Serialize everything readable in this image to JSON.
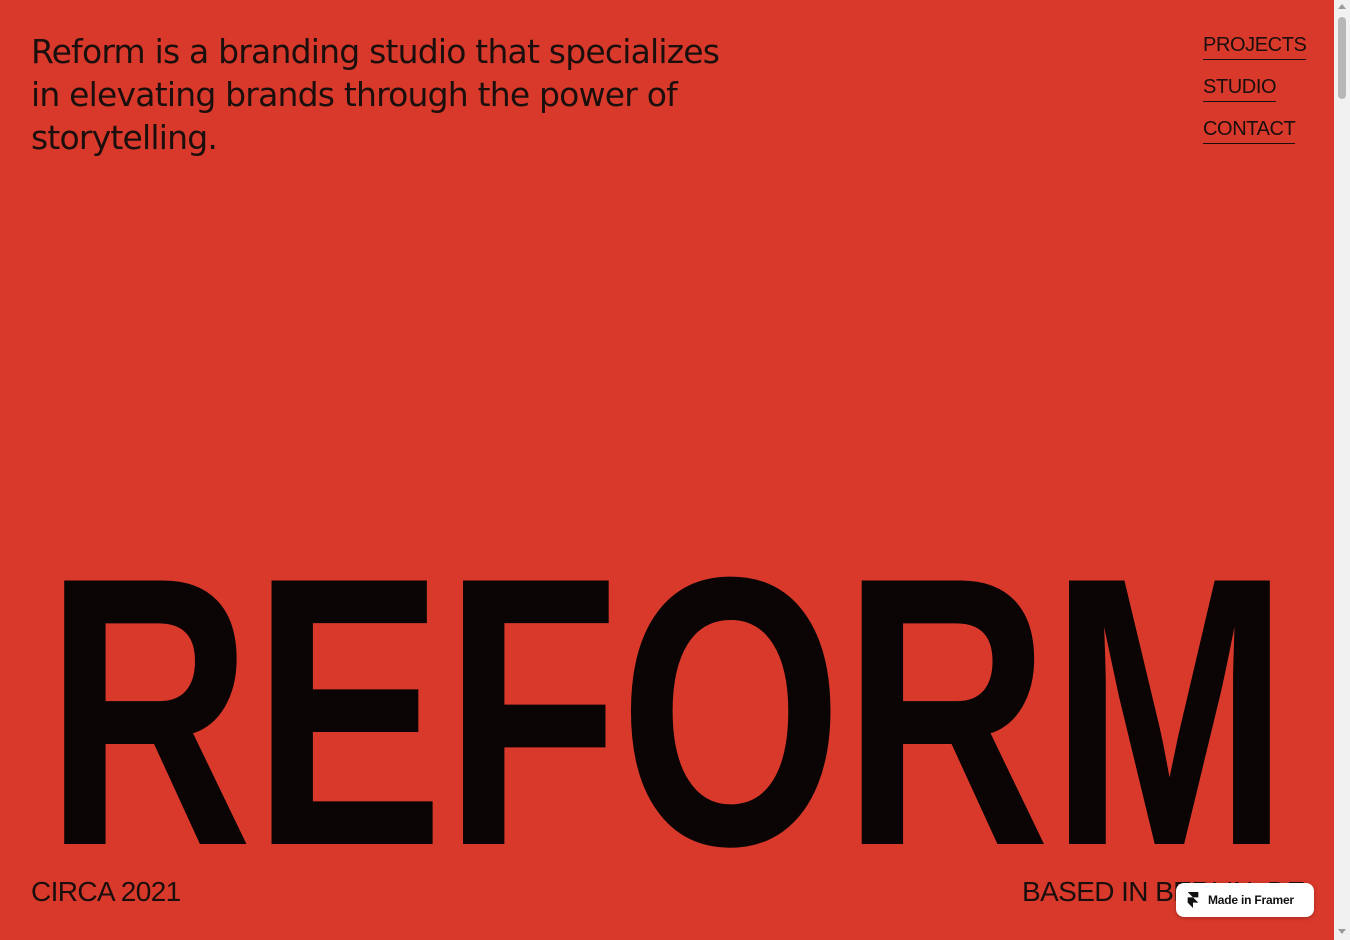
{
  "colors": {
    "background": "#d9392b",
    "ink": "#1a0f0d",
    "wordmark": "#0a0504",
    "badge_bg": "#ffffff"
  },
  "hero": {
    "tagline": "Reform is a branding studio that specializes in elevating brands through the power of storytelling.",
    "wordmark": "REFORM"
  },
  "nav": {
    "items": [
      {
        "label": "PROJECTS"
      },
      {
        "label": "STUDIO"
      },
      {
        "label": "CONTACT"
      }
    ]
  },
  "footer": {
    "left": "CIRCA 2021",
    "right": "BASED IN BERLIN, DE"
  },
  "badge": {
    "icon": "framer-icon",
    "label": "Made in Framer"
  }
}
